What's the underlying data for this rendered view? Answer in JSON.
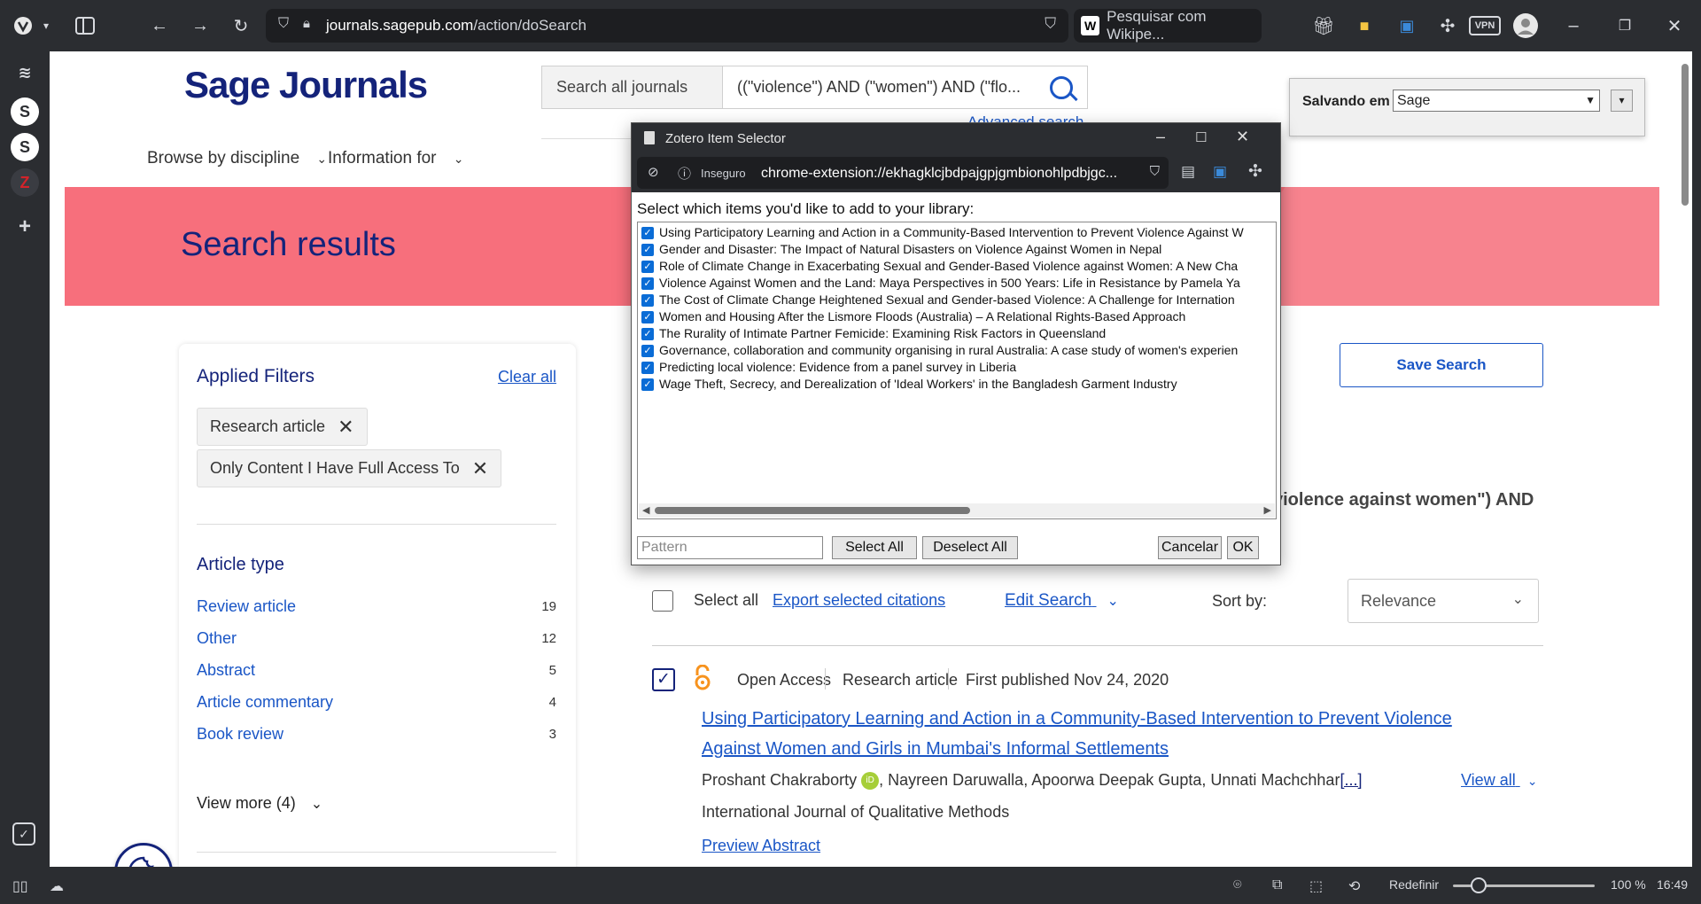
{
  "browser": {
    "url_host": "journals.sagepub.com",
    "url_path": "/action/doSearch",
    "wiki_search": "Pesquisar com Wikipe...",
    "vpn": "VPN"
  },
  "site": {
    "logo": "Sage Journals",
    "search_scope": "Search all journals",
    "search_query": "((\"violence\") AND (\"women\") AND (\"flo...",
    "advanced_search": "Advanced search",
    "nav": [
      "Browse by discipline",
      "Information for"
    ],
    "page_title": "Search results"
  },
  "filters": {
    "title": "Applied Filters",
    "clear_all": "Clear all",
    "chips": [
      "Research article",
      "Only Content I Have Full Access To"
    ],
    "article_type_title": "Article type",
    "facets": [
      {
        "label": "Review article",
        "count": "19"
      },
      {
        "label": "Other",
        "count": "12"
      },
      {
        "label": "Abstract",
        "count": "5"
      },
      {
        "label": "Article commentary",
        "count": "4"
      },
      {
        "label": "Book review",
        "count": "3"
      }
    ],
    "view_more": "View more (4)"
  },
  "results": {
    "save_search": "Save Search",
    "query_line1": "violence against women\") AND",
    "select_all": "Select all",
    "export": "Export selected citations",
    "edit_search": "Edit Search",
    "sort_by": "Sort by:",
    "sort_value": "Relevance",
    "item": {
      "access": "Open Access",
      "type": "Research article",
      "published": "First published Nov 24, 2020",
      "title": "Using Participatory Learning and Action in a Community-Based Intervention to Prevent Violence Against Women and Girls in Mumbai's Informal Settlements",
      "authors": [
        "Proshant Chakraborty",
        "Nayreen Daruwalla",
        "Apoorwa Deepak Gupta",
        "Unnati Machchhar"
      ],
      "more_authors": "[...]",
      "view_all": "View all",
      "journal": "International Journal of Qualitative Methods",
      "preview": "Preview Abstract"
    }
  },
  "zotero_save": {
    "label": "Salvando em",
    "target": "Sage"
  },
  "zotero_selector": {
    "window_title": "Zotero Item Selector",
    "insecure": "Inseguro",
    "address": "chrome-extension://ekhagklcjbdpajgpjgmbionohlpdbjgc...",
    "prompt": "Select which items you'd like to add to your library:",
    "items": [
      "Using Participatory Learning and Action in a Community-Based Intervention to Prevent Violence Against W",
      "Gender and Disaster: The Impact of Natural Disasters on Violence Against Women in Nepal",
      "Role of Climate Change in Exacerbating Sexual and Gender-Based Violence against Women: A New Cha",
      "Violence Against Women and the Land: Maya Perspectives in 500 Years: Life in Resistance by Pamela Ya",
      "The Cost of Climate Change Heightened Sexual and Gender-based Violence: A Challenge for Internation",
      "Women and Housing After the Lismore Floods (Australia) – A Relational Rights-Based Approach",
      "The Rurality of Intimate Partner Femicide: Examining Risk Factors in Queensland",
      "Governance, collaboration and community organising in rural Australia: A case study of women's experien",
      "Predicting local violence: Evidence from a panel survey in Liberia",
      "Wage Theft, Secrecy, and Derealization of 'Ideal Workers' in the Bangladesh Garment Industry"
    ],
    "pattern_placeholder": "Pattern",
    "select_all": "Select All",
    "deselect_all": "Deselect All",
    "cancel": "Cancelar",
    "ok": "OK"
  },
  "statusbar": {
    "reset": "Redefinir",
    "zoom": "100 %",
    "time": "16:49"
  },
  "colors": {
    "brand_navy": "#14237a",
    "link_blue": "#1a56c6",
    "hero_pink": "#f76f7c",
    "checkbox_blue": "#0a6cd6"
  }
}
